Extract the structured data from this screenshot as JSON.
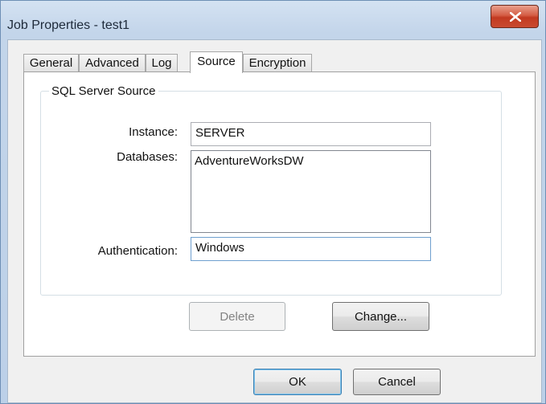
{
  "window": {
    "title": "Job Properties - test1",
    "close_label": "X"
  },
  "tabs": [
    {
      "label": "General",
      "active": false
    },
    {
      "label": "Advanced",
      "active": false
    },
    {
      "label": "Log",
      "active": false
    },
    {
      "label": "Source",
      "active": true
    },
    {
      "label": "Encryption",
      "active": false
    }
  ],
  "group": {
    "title": "SQL Server Source",
    "instance_label": "Instance:",
    "instance_value": "SERVER",
    "databases_label": "Databases:",
    "databases": [
      "AdventureWorksDW"
    ],
    "authentication_label": "Authentication:",
    "authentication_value": "Windows"
  },
  "buttons": {
    "delete": "Delete",
    "change": "Change...",
    "ok": "OK",
    "cancel": "Cancel"
  },
  "colors": {
    "close_button": "#c94a30",
    "title_bar": "#c3d5ea",
    "focus_border": "#6fa0cf"
  }
}
